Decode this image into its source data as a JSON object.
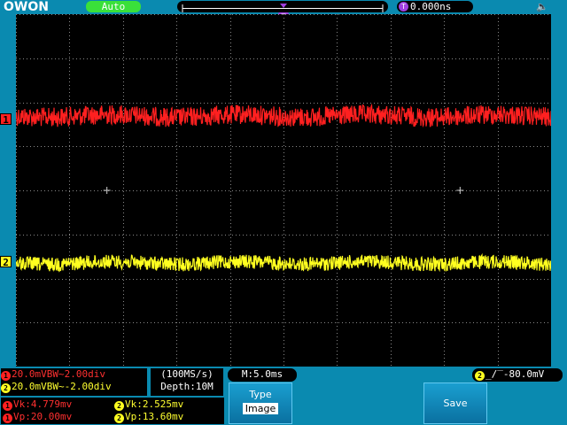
{
  "brand": "OWON",
  "header": {
    "mode": "Auto",
    "trigger_position": "0.000ns",
    "time_marker_label": "T",
    "trigger_icon_label": "T"
  },
  "channels": {
    "ch1": {
      "id": "1",
      "color": "#ff2020"
    },
    "ch2": {
      "id": "2",
      "color": "#ffff20"
    }
  },
  "status": {
    "ch1_line": "20.0mVBW~2.00div",
    "ch2_line": "20.0mVBW~-2.00div",
    "sample_rate": "(100MS/s)",
    "depth": "Depth:10M",
    "timebase": "M:5.0ms",
    "trigger_level": "-80.0mV",
    "trigger_edge_symbol": "_/‾"
  },
  "measurements": {
    "ch1_vk": "Vk:4.779mv",
    "ch1_vp": "Vp:20.00mv",
    "ch2_vk": "Vk:2.525mv",
    "ch2_vp": "Vp:13.60mv"
  },
  "menu": {
    "type_label": "Type",
    "type_value": "Image",
    "save_label": "Save"
  },
  "colors": {
    "background": "#0a8ab0",
    "screen": "#000000",
    "ch1": "#ff2020",
    "ch2": "#ffff20",
    "mode_ok": "#3ae03a",
    "trigger": "#a040e0"
  }
}
